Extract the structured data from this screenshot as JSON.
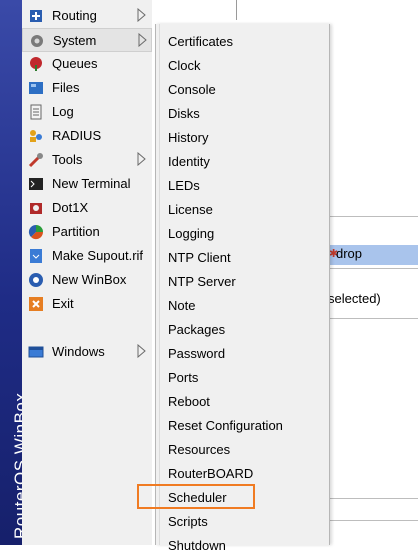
{
  "brand": "RouterOS WinBox",
  "main_menu": [
    {
      "label": "Routing",
      "icon": "routing-icon",
      "submenu": true
    },
    {
      "label": "System",
      "icon": "system-gear-icon",
      "submenu": true,
      "active": true
    },
    {
      "label": "Queues",
      "icon": "queues-icon"
    },
    {
      "label": "Files",
      "icon": "files-folder-icon"
    },
    {
      "label": "Log",
      "icon": "log-icon"
    },
    {
      "label": "RADIUS",
      "icon": "radius-users-icon"
    },
    {
      "label": "Tools",
      "icon": "tools-icon",
      "submenu": true
    },
    {
      "label": "New Terminal",
      "icon": "terminal-icon"
    },
    {
      "label": "Dot1X",
      "icon": "dot1x-icon"
    },
    {
      "label": "Partition",
      "icon": "partition-pie-icon"
    },
    {
      "label": "Make Supout.rif",
      "icon": "supout-file-icon"
    },
    {
      "label": "New WinBox",
      "icon": "winbox-icon"
    },
    {
      "label": "Exit",
      "icon": "exit-icon"
    },
    {
      "label": "Windows",
      "icon": "windows-icon",
      "submenu": true
    }
  ],
  "system_submenu": [
    "Certificates",
    "Clock",
    "Console",
    "Disks",
    "History",
    "Identity",
    "LEDs",
    "License",
    "Logging",
    "NTP Client",
    "NTP Server",
    "Note",
    "Packages",
    "Password",
    "Ports",
    "Reboot",
    "Reset Configuration",
    "Resources",
    "RouterBOARD",
    "Scheduler",
    "Scripts",
    "Shutdown"
  ],
  "highlighted_item": "Scheduler",
  "background": {
    "rule_action": "drop",
    "status": "selected)"
  },
  "colors": {
    "brand_strip": "#1f2c86",
    "menu_bg": "#f0f0f0",
    "highlight": "#f07b22",
    "selected_row": "#a9c4ec"
  }
}
